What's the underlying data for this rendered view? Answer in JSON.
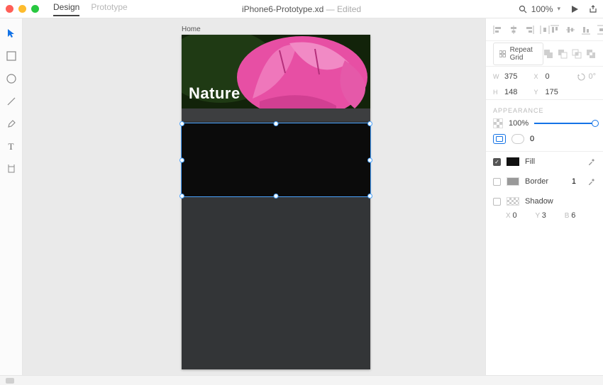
{
  "titlebar": {
    "tabs": [
      {
        "label": "Design",
        "active": true
      },
      {
        "label": "Prototype",
        "active": false
      }
    ],
    "filename": "iPhone6-Prototype.xd",
    "edited_suffix": " — Edited",
    "zoom": "100%"
  },
  "canvas": {
    "artboard_label": "Home",
    "hero_text": "Nature"
  },
  "inspector": {
    "repeat_grid_label": "Repeat Grid",
    "size": {
      "w_label": "W",
      "w": "375",
      "h_label": "H",
      "h": "148"
    },
    "pos": {
      "x_label": "X",
      "x": "0",
      "y_label": "Y",
      "y": "175"
    },
    "rotation": "0°",
    "appearance_title": "APPEARANCE",
    "opacity": "100%",
    "corner_radius": "0",
    "fill": {
      "label": "Fill",
      "color": "#000000",
      "checked": true
    },
    "border": {
      "label": "Border",
      "color": "#9d9d9d",
      "checked": false,
      "width": "1"
    },
    "shadow": {
      "label": "Shadow",
      "checked": false,
      "x_label": "X",
      "x": "0",
      "y_label": "Y",
      "y": "3",
      "b_label": "B",
      "b": "6"
    }
  }
}
